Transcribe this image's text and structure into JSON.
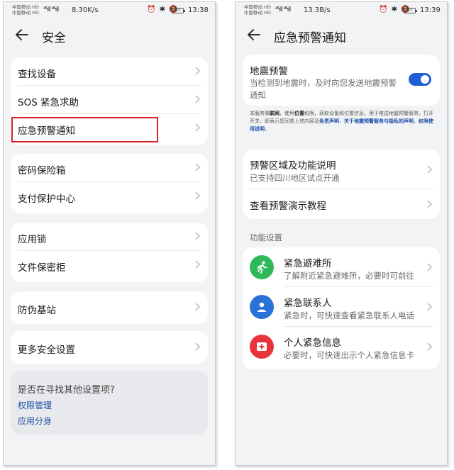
{
  "left_screen": {
    "status": {
      "carrier_top": "中国移动 HD",
      "carrier_bottom": "中国移动 HD",
      "signal": "⁴⁶ıll ⁴⁶ıll",
      "net_speed": "8.30K/s",
      "icons": "⏰ ✱ 🔕",
      "battery": "67",
      "time": "13:38"
    },
    "title": "安全",
    "groups": [
      {
        "items": [
          "查找设备",
          "SOS 紧急求助",
          "应急预警通知"
        ]
      },
      {
        "items": [
          "密码保险箱",
          "支付保护中心"
        ]
      },
      {
        "items": [
          "应用锁",
          "文件保密柜"
        ]
      },
      {
        "items": [
          "防伪基站"
        ]
      },
      {
        "items": [
          "更多安全设置"
        ]
      }
    ],
    "suggest": {
      "question": "是否在寻找其他设置项?",
      "links": [
        "权限管理",
        "应用分身"
      ]
    },
    "highlight_color": "#d9242b"
  },
  "right_screen": {
    "status": {
      "carrier_top": "中国移动 HD",
      "carrier_bottom": "中国移动 HD",
      "signal": "⁴⁶ıll ⁴⁶ıll",
      "net_speed": "13.3B/s",
      "icons": "⏰ ✱ 🔕",
      "battery": "67",
      "time": "13:39"
    },
    "title": "应急预警通知",
    "earthquake": {
      "title": "地震预警",
      "desc": "当检测到地震时，及时向您发送地震预警通知",
      "enabled": true,
      "toggle_color": "#1f5fd6"
    },
    "notice": {
      "p1": "本服务需",
      "b1": "联网",
      "p2": "，使用",
      "b2": "位置",
      "p3": "权限，获取设备和位置信息，用于推送地震预警服务。打开开关，即表示您同意上述内容及",
      "l1": "免责声明",
      "p4": "、",
      "l2": "关于地震预警服务与隐私的声明",
      "p5": "、",
      "l3": "权限使用说明",
      "p6": "。"
    },
    "info_rows": [
      {
        "title": "预警区域及功能说明",
        "sub": "已支持四川地区试点开通"
      },
      {
        "title": "查看预警演示教程",
        "sub": ""
      }
    ],
    "section_label": "功能设置",
    "features": [
      {
        "title": "紧急避难所",
        "sub": "了解附近紧急避难所，必要时可前往",
        "icon": "running-person-icon",
        "color": "#2fb85a"
      },
      {
        "title": "紧急联系人",
        "sub": "紧急时，可快速查看紧急联系人电话",
        "icon": "contact-person-icon",
        "color": "#2a72d8"
      },
      {
        "title": "个人紧急信息",
        "sub": "必要时，可快速出示个人紧急信息卡",
        "icon": "medical-card-icon",
        "color": "#e8333b"
      }
    ]
  }
}
